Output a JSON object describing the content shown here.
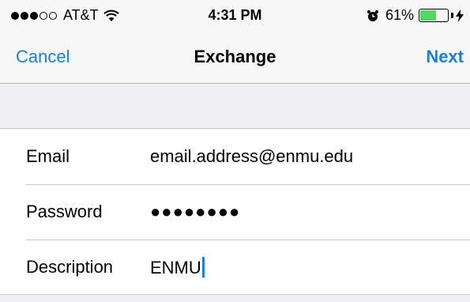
{
  "status_bar": {
    "carrier": "AT&T",
    "signal_bars_filled": 3,
    "signal_bars_total": 5,
    "time": "4:31 PM",
    "battery_percent": "61%",
    "battery_level": 0.61,
    "icons": [
      "wifi-icon",
      "alarm-icon",
      "battery-icon",
      "charging-bolt-icon"
    ]
  },
  "nav": {
    "cancel_label": "Cancel",
    "title": "Exchange",
    "next_label": "Next"
  },
  "form": {
    "rows": [
      {
        "label": "Email",
        "value": "email.address@enmu.edu"
      },
      {
        "label": "Password",
        "value": "●●●●●●●●"
      },
      {
        "label": "Description",
        "value": "ENMU"
      }
    ]
  },
  "colors": {
    "accent": "#1a7ee6",
    "battery": "#4cd964",
    "separator": "#c8c7cc",
    "group_background": "#efeff4"
  }
}
